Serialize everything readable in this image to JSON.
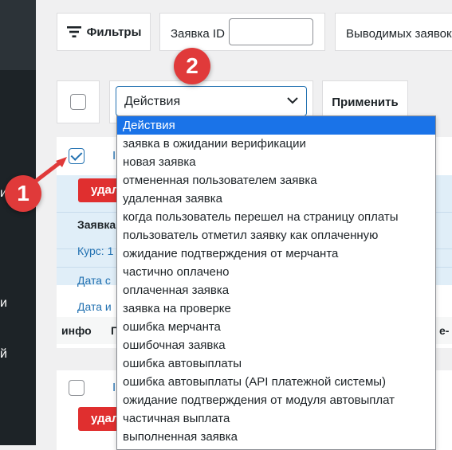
{
  "toolbar": {
    "filters_label": "Фильтры",
    "request_id_label": "Заявка ID",
    "request_id_value": "",
    "output_count_label": "Выводимых заявок"
  },
  "bulk": {
    "select_value": "Действия",
    "apply_label": "Применить"
  },
  "badges": {
    "first": "1",
    "second": "2"
  },
  "sidebar": {
    "fragments": [
      "и",
      "и",
      "й"
    ]
  },
  "dropdown": {
    "options": [
      "Действия",
      "заявка в ожидании верификации",
      "новая заявка",
      "отмененная пользователем заявка",
      "удаленная заявка",
      "когда пользователь перешел на страницу оплаты",
      "пользователь отметил заявку как оплаченную",
      "ожидание подтверждения от мерчанта",
      "частично оплачено",
      "оплаченная заявка",
      "заявка на проверке",
      "ошибка мерчанта",
      "ошибочная заявка",
      "ошибка автовыплаты",
      "ошибка автовыплаты (API платежной системы)",
      "ожидание подтверждения от модуля автовыплат",
      "частичная выплата",
      "выполненная заявка"
    ],
    "selected_index": 0
  },
  "card1": {
    "header_link": "I",
    "delete_label": "удал",
    "row_request": "Заявка",
    "row_rate": "Курс: 1",
    "row_date1": "Дата с",
    "row_date2": "Дата и",
    "info_label": "инфо",
    "info_p": "П",
    "info_e": "е-"
  },
  "card2": {
    "header_link": "I",
    "delete_label": "удал"
  },
  "colors": {
    "accent": "#2271b1",
    "danger": "#e02f2f",
    "badge": "#e03a3a",
    "dropdown_selected": "#1a73e8"
  }
}
